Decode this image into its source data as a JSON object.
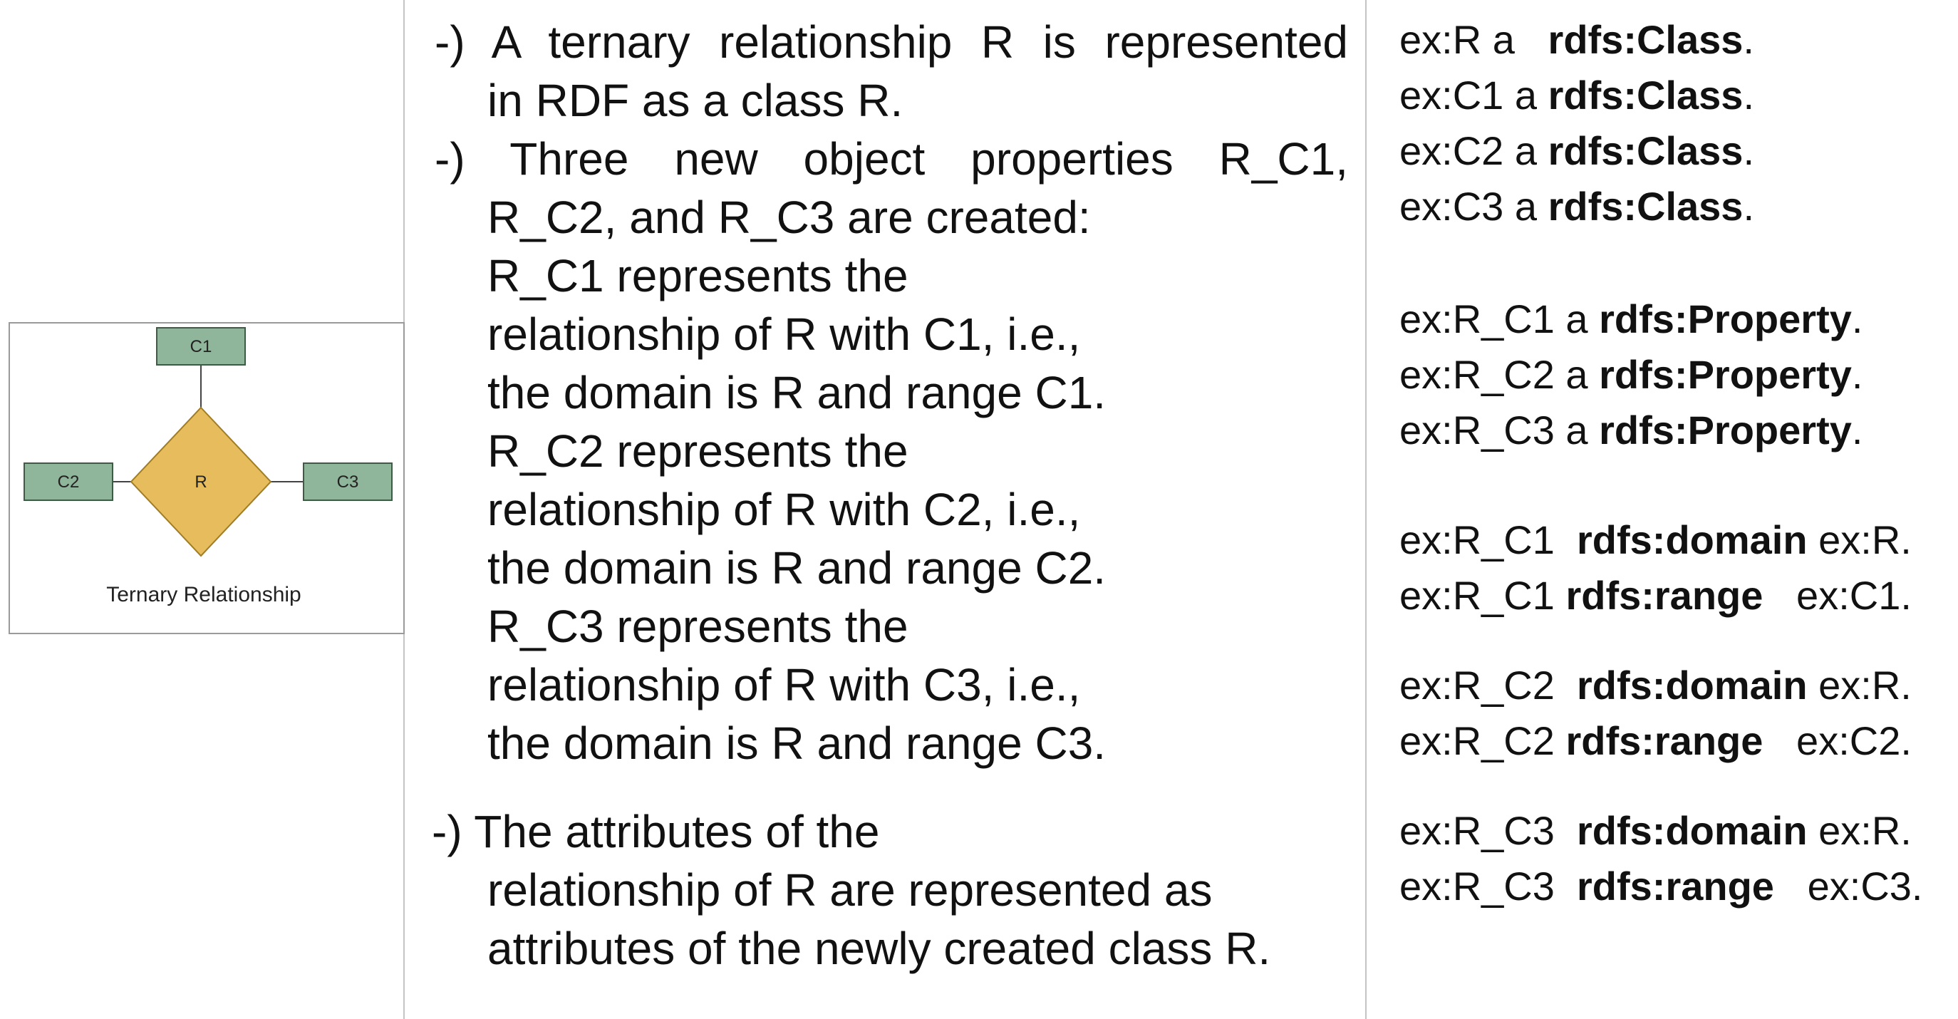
{
  "figure": {
    "entities": [
      "C1",
      "C2",
      "C3"
    ],
    "relationship": "R",
    "caption": "Ternary Relationship",
    "colors": {
      "entity_fill": "#8fb59a",
      "entity_stroke": "#3d5b45",
      "relationship_fill": "#e6bc5c",
      "relationship_stroke": "#a07c25",
      "line": "#444444"
    }
  },
  "middle": {
    "lines": [
      "-) A ternary relationship R is represented",
      "in RDF as a class R.",
      "-) Three new object properties R_C1,",
      "R_C2, and R_C3 are created:",
      "R_C1 represents the",
      "relationship of R with C1, i.e.,",
      "the domain is R and range C1.",
      "R_C2 represents the",
      "relationship of R with C2, i.e.,",
      "the domain is R and range C2.",
      "R_C3 represents the",
      "relationship of R with C3, i.e.,",
      "the domain is R and range C3.",
      "-) The attributes of the",
      "relationship of R are represented as",
      "attributes of the newly created class R."
    ]
  },
  "code": {
    "lines": [
      {
        "pre": "ex:R a   ",
        "bold": "rdfs:Class",
        "post": "."
      },
      {
        "pre": "ex:C1 a ",
        "bold": "rdfs:Class",
        "post": "."
      },
      {
        "pre": "ex:C2 a ",
        "bold": "rdfs:Class",
        "post": "."
      },
      {
        "pre": "ex:C3 a ",
        "bold": "rdfs:Class",
        "post": "."
      },
      {
        "pre": "ex:R_C1 a ",
        "bold": "rdfs:Property",
        "post": "."
      },
      {
        "pre": "ex:R_C2 a ",
        "bold": "rdfs:Property",
        "post": "."
      },
      {
        "pre": "ex:R_C3 a ",
        "bold": "rdfs:Property",
        "post": "."
      },
      {
        "pre": "ex:R_C1  ",
        "bold": "rdfs:domain",
        "post": " ex:R."
      },
      {
        "pre": "ex:R_C1 ",
        "bold": "rdfs:range",
        "post": "   ex:C1."
      },
      {
        "pre": "ex:R_C2  ",
        "bold": "rdfs:domain",
        "post": " ex:R."
      },
      {
        "pre": "ex:R_C2 ",
        "bold": "rdfs:range",
        "post": "   ex:C2."
      },
      {
        "pre": "ex:R_C3  ",
        "bold": "rdfs:domain",
        "post": " ex:R."
      },
      {
        "pre": "ex:R_C3  ",
        "bold": "rdfs:range",
        "post": "   ex:C3."
      }
    ]
  }
}
